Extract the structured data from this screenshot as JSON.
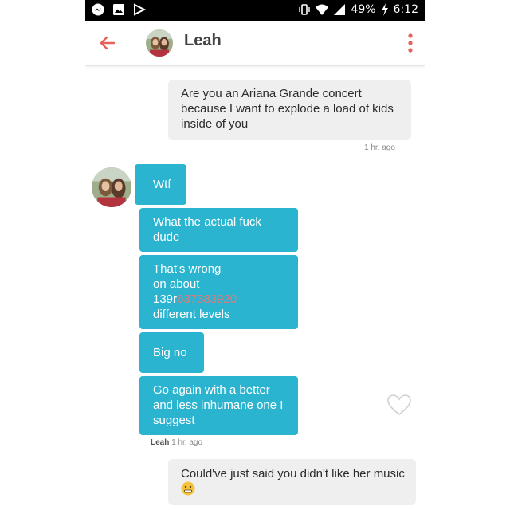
{
  "status_bar": {
    "battery": "49%",
    "time": "6:12",
    "icons": [
      "messenger-icon",
      "image-icon",
      "flag-icon",
      "vibrate-icon",
      "wifi-icon",
      "signal-icon",
      "battery-charging-icon"
    ]
  },
  "header": {
    "name": "Leah"
  },
  "messages": {
    "m1": {
      "text": "Are you an Ariana Grande concert because I want to explode a load of kids inside of you",
      "time": "1 hr. ago"
    },
    "r1": {
      "text": "Wtf"
    },
    "r2": {
      "text": "What the actual fuck dude"
    },
    "r3": {
      "line1": "That's wrong",
      "line2": "on about",
      "num_prefix": "139r",
      "num_link": "637383920",
      "line4": "different levels"
    },
    "r4": {
      "text": "Big no"
    },
    "r5": {
      "text": "Go again with a better and less inhumane one I suggest"
    },
    "r_meta": {
      "sender": "Leah",
      "time": "1 hr. ago"
    },
    "m2": {
      "text": "Could've just said you didn't like her music",
      "emoji": "grimace-emoji"
    }
  },
  "colors": {
    "received_bubble": "#2bb4d0",
    "sent_bubble": "#efefef",
    "accent": "#e8605a"
  }
}
